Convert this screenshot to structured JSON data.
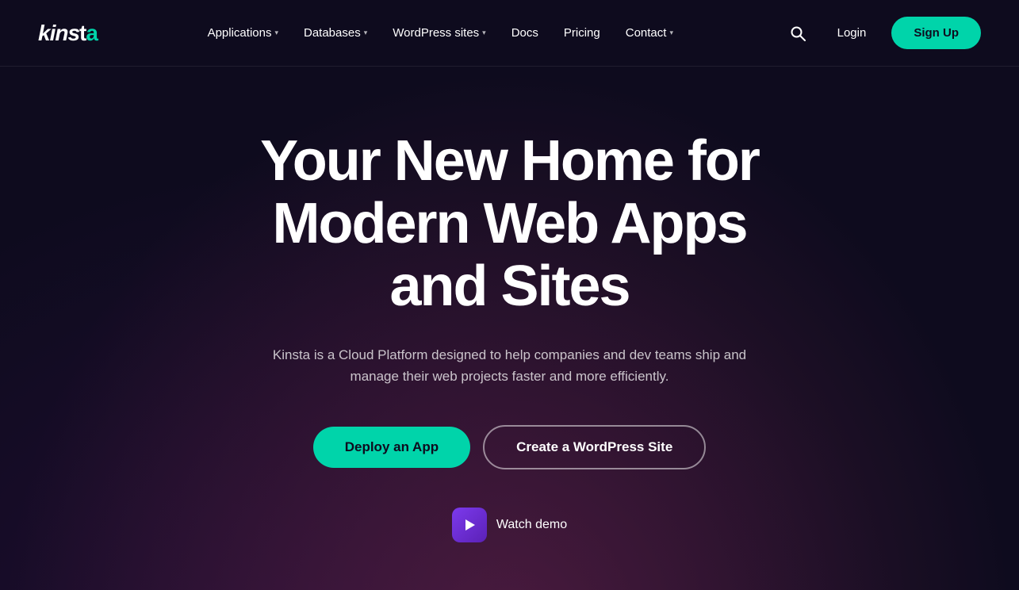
{
  "brand": {
    "name": "kinsta",
    "logo_text": "KINSTa"
  },
  "nav": {
    "links": [
      {
        "label": "Applications",
        "has_dropdown": true
      },
      {
        "label": "Databases",
        "has_dropdown": true
      },
      {
        "label": "WordPress sites",
        "has_dropdown": true
      },
      {
        "label": "Docs",
        "has_dropdown": false
      },
      {
        "label": "Pricing",
        "has_dropdown": false
      },
      {
        "label": "Contact",
        "has_dropdown": true
      }
    ],
    "login_label": "Login",
    "signup_label": "Sign Up",
    "search_title": "Search"
  },
  "hero": {
    "title": "Your New Home for Modern Web Apps and Sites",
    "subtitle": "Kinsta is a Cloud Platform designed to help companies and dev teams ship and manage their web projects faster and more efficiently.",
    "deploy_btn": "Deploy an App",
    "wordpress_btn": "Create a WordPress Site",
    "watch_demo_label": "Watch demo"
  },
  "colors": {
    "accent": "#00d4aa",
    "bg": "#0e0b1e",
    "play_btn_bg": "#6d28d9"
  }
}
